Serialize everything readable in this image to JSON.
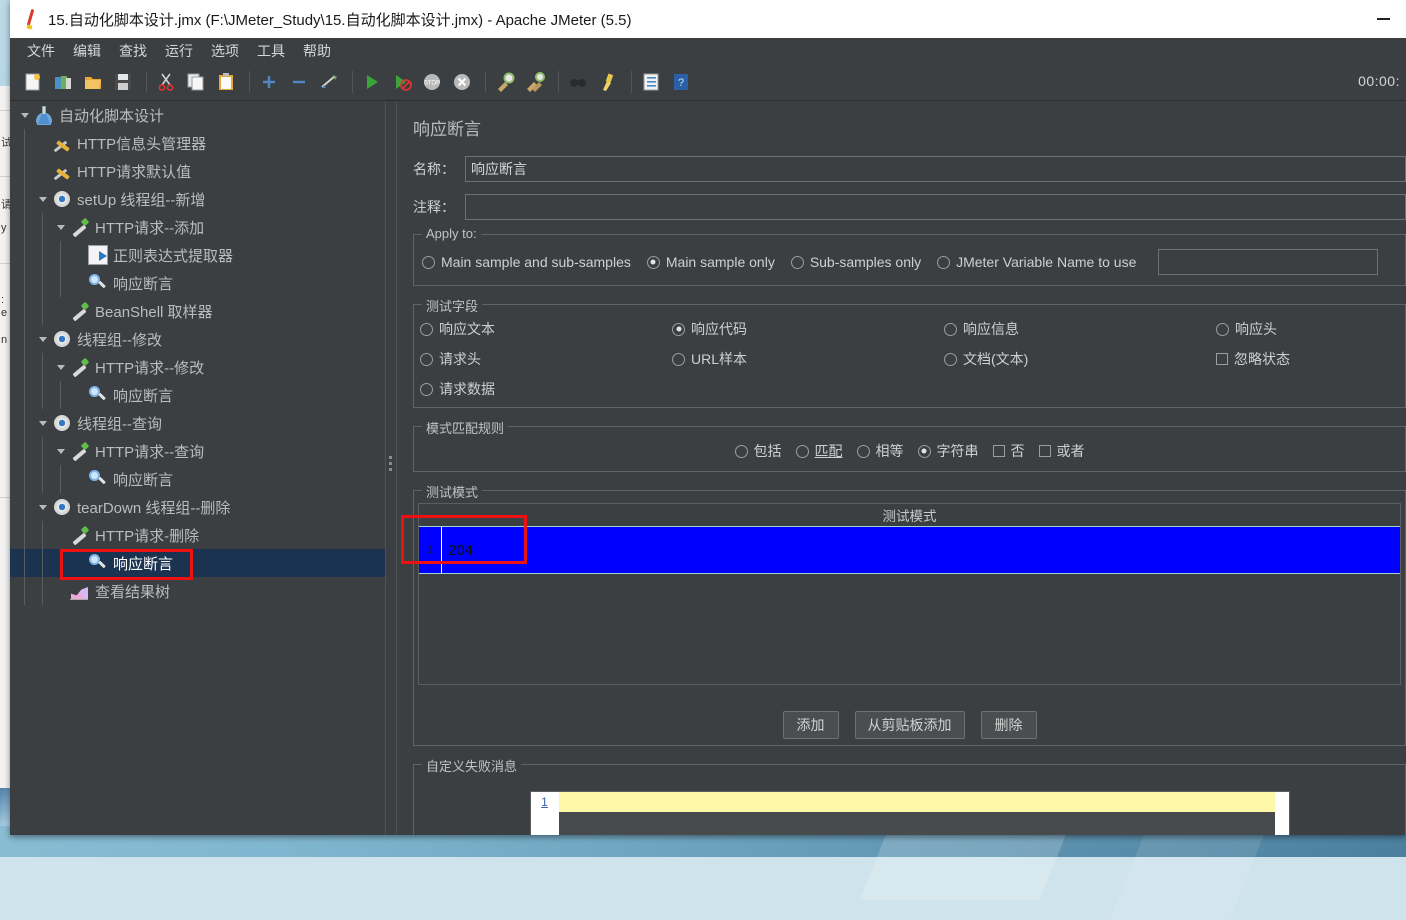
{
  "window": {
    "title": "15.自动化脚本设计.jmx (F:\\JMeter_Study\\15.自动化脚本设计.jmx) - Apache JMeter (5.5)",
    "minimize_label": "—",
    "timer": "00:00:"
  },
  "menu": {
    "items": [
      {
        "label": "文件",
        "name": "menu-file"
      },
      {
        "label": "编辑",
        "name": "menu-edit"
      },
      {
        "label": "查找",
        "name": "menu-search"
      },
      {
        "label": "运行",
        "name": "menu-run"
      },
      {
        "label": "选项",
        "name": "menu-options"
      },
      {
        "label": "工具",
        "name": "menu-tools"
      },
      {
        "label": "帮助",
        "name": "menu-help"
      }
    ]
  },
  "toolbar": {
    "buttons": [
      {
        "icon": "new-file-icon",
        "tip": "新建"
      },
      {
        "icon": "templates-icon",
        "tip": "模板"
      },
      {
        "icon": "open-folder-icon",
        "tip": "打开"
      },
      {
        "icon": "save-icon",
        "tip": "保存"
      },
      {
        "sep": true
      },
      {
        "icon": "cut-icon",
        "tip": "剪切"
      },
      {
        "icon": "copy-icon",
        "tip": "复制"
      },
      {
        "icon": "paste-icon",
        "tip": "粘贴"
      },
      {
        "sep": true
      },
      {
        "icon": "expand-all-icon",
        "tip": "展开"
      },
      {
        "icon": "collapse-all-icon",
        "tip": "折叠"
      },
      {
        "icon": "toggle-icon",
        "tip": "切换"
      },
      {
        "sep": true
      },
      {
        "icon": "start-icon",
        "tip": "启动"
      },
      {
        "icon": "start-no-timers-icon",
        "tip": "无间隔启动"
      },
      {
        "icon": "stop-icon",
        "tip": "停止"
      },
      {
        "icon": "shutdown-icon",
        "tip": "关闭"
      },
      {
        "sep": true
      },
      {
        "icon": "clear-icon",
        "tip": "清除"
      },
      {
        "icon": "clear-all-icon",
        "tip": "清除全部"
      },
      {
        "sep": true
      },
      {
        "icon": "search-icon",
        "tip": "搜索"
      },
      {
        "icon": "reset-search-icon",
        "tip": "重置搜索"
      },
      {
        "sep": true
      },
      {
        "icon": "function-helper-icon",
        "tip": "函数助手"
      },
      {
        "icon": "help-icon",
        "tip": "帮助"
      }
    ]
  },
  "tree": {
    "nodes": [
      {
        "label": "自动化脚本设计",
        "icon": "test-plan-icon",
        "depth": 0,
        "expanded": true,
        "selected": false
      },
      {
        "label": "HTTP信息头管理器",
        "icon": "config-tool-icon",
        "depth": 1,
        "expanded": null,
        "selected": false
      },
      {
        "label": "HTTP请求默认值",
        "icon": "config-tool-icon",
        "depth": 1,
        "expanded": null,
        "selected": false
      },
      {
        "label": "setUp 线程组--新增",
        "icon": "thread-group-icon",
        "depth": 1,
        "expanded": true,
        "selected": false
      },
      {
        "label": "HTTP请求--添加",
        "icon": "http-sampler-icon",
        "depth": 2,
        "expanded": true,
        "selected": false
      },
      {
        "label": "正则表达式提取器",
        "icon": "regex-extractor-icon",
        "depth": 3,
        "expanded": null,
        "selected": false
      },
      {
        "label": "响应断言",
        "icon": "assertion-icon",
        "depth": 3,
        "expanded": null,
        "selected": false
      },
      {
        "label": "BeanShell 取样器",
        "icon": "http-sampler-icon",
        "depth": 2,
        "expanded": null,
        "selected": false
      },
      {
        "label": "线程组--修改",
        "icon": "thread-group-icon",
        "depth": 1,
        "expanded": true,
        "selected": false
      },
      {
        "label": "HTTP请求--修改",
        "icon": "http-sampler-icon",
        "depth": 2,
        "expanded": true,
        "selected": false
      },
      {
        "label": "响应断言",
        "icon": "assertion-icon",
        "depth": 3,
        "expanded": null,
        "selected": false
      },
      {
        "label": "线程组--查询",
        "icon": "thread-group-icon",
        "depth": 1,
        "expanded": true,
        "selected": false
      },
      {
        "label": "HTTP请求--查询",
        "icon": "http-sampler-icon",
        "depth": 2,
        "expanded": true,
        "selected": false
      },
      {
        "label": "响应断言",
        "icon": "assertion-icon",
        "depth": 3,
        "expanded": null,
        "selected": false
      },
      {
        "label": "tearDown 线程组--删除",
        "icon": "thread-group-icon",
        "depth": 1,
        "expanded": true,
        "selected": false
      },
      {
        "label": "HTTP请求-删除",
        "icon": "http-sampler-icon",
        "depth": 2,
        "expanded": null,
        "selected": false
      },
      {
        "label": "响应断言",
        "icon": "assertion-icon",
        "depth": 3,
        "expanded": null,
        "selected": true
      },
      {
        "label": "查看结果树",
        "icon": "view-results-tree-icon",
        "depth": 2,
        "expanded": null,
        "selected": false
      }
    ]
  },
  "panel": {
    "title": "响应断言",
    "name_label": "名称：",
    "name_value": "响应断言",
    "comment_label": "注释：",
    "comment_value": "",
    "apply_to": {
      "legend": "Apply to:",
      "options": [
        {
          "label": "Main sample and sub-samples",
          "selected": false
        },
        {
          "label": "Main sample only",
          "selected": true
        },
        {
          "label": "Sub-samples only",
          "selected": false
        },
        {
          "label": "JMeter Variable Name to use",
          "selected": false
        }
      ],
      "variable_value": ""
    },
    "test_field": {
      "legend": "测试字段",
      "options": [
        {
          "label": "响应文本",
          "selected": false,
          "type": "radio",
          "col": 1
        },
        {
          "label": "响应代码",
          "selected": true,
          "type": "radio",
          "col": 2
        },
        {
          "label": "响应信息",
          "selected": false,
          "type": "radio",
          "col": 3
        },
        {
          "label": "响应头",
          "selected": false,
          "type": "radio",
          "col": 4
        },
        {
          "label": "请求头",
          "selected": false,
          "type": "radio",
          "col": 1
        },
        {
          "label": "URL样本",
          "selected": false,
          "type": "radio",
          "col": 2
        },
        {
          "label": "文档(文本)",
          "selected": false,
          "type": "radio",
          "col": 3
        },
        {
          "label": "忽略状态",
          "selected": false,
          "type": "checkbox",
          "col": 4
        },
        {
          "label": "请求数据",
          "selected": false,
          "type": "radio",
          "col": 1
        }
      ]
    },
    "match_rules": {
      "legend": "模式匹配规则",
      "options": [
        {
          "label": "包括",
          "selected": false,
          "type": "radio",
          "underline": false
        },
        {
          "label": "匹配",
          "selected": false,
          "type": "radio",
          "underline": true
        },
        {
          "label": "相等",
          "selected": false,
          "type": "radio",
          "underline": false
        },
        {
          "label": "字符串",
          "selected": true,
          "type": "radio",
          "underline": false
        },
        {
          "label": "否",
          "selected": false,
          "type": "checkbox",
          "underline": false
        },
        {
          "label": "或者",
          "selected": false,
          "type": "checkbox",
          "underline": false
        }
      ]
    },
    "test_patterns": {
      "legend": "测试模式",
      "column_header": "测试模式",
      "rows": [
        {
          "num": "1",
          "value": "204"
        }
      ]
    },
    "buttons": [
      {
        "label": "添加",
        "name": "add-pattern-button"
      },
      {
        "label": "从剪贴板添加",
        "name": "add-from-clipboard-button"
      },
      {
        "label": "删除",
        "name": "delete-pattern-button"
      }
    ],
    "failure_message": {
      "legend": "自定义失败消息",
      "gutter_line": "1",
      "value": ""
    }
  }
}
